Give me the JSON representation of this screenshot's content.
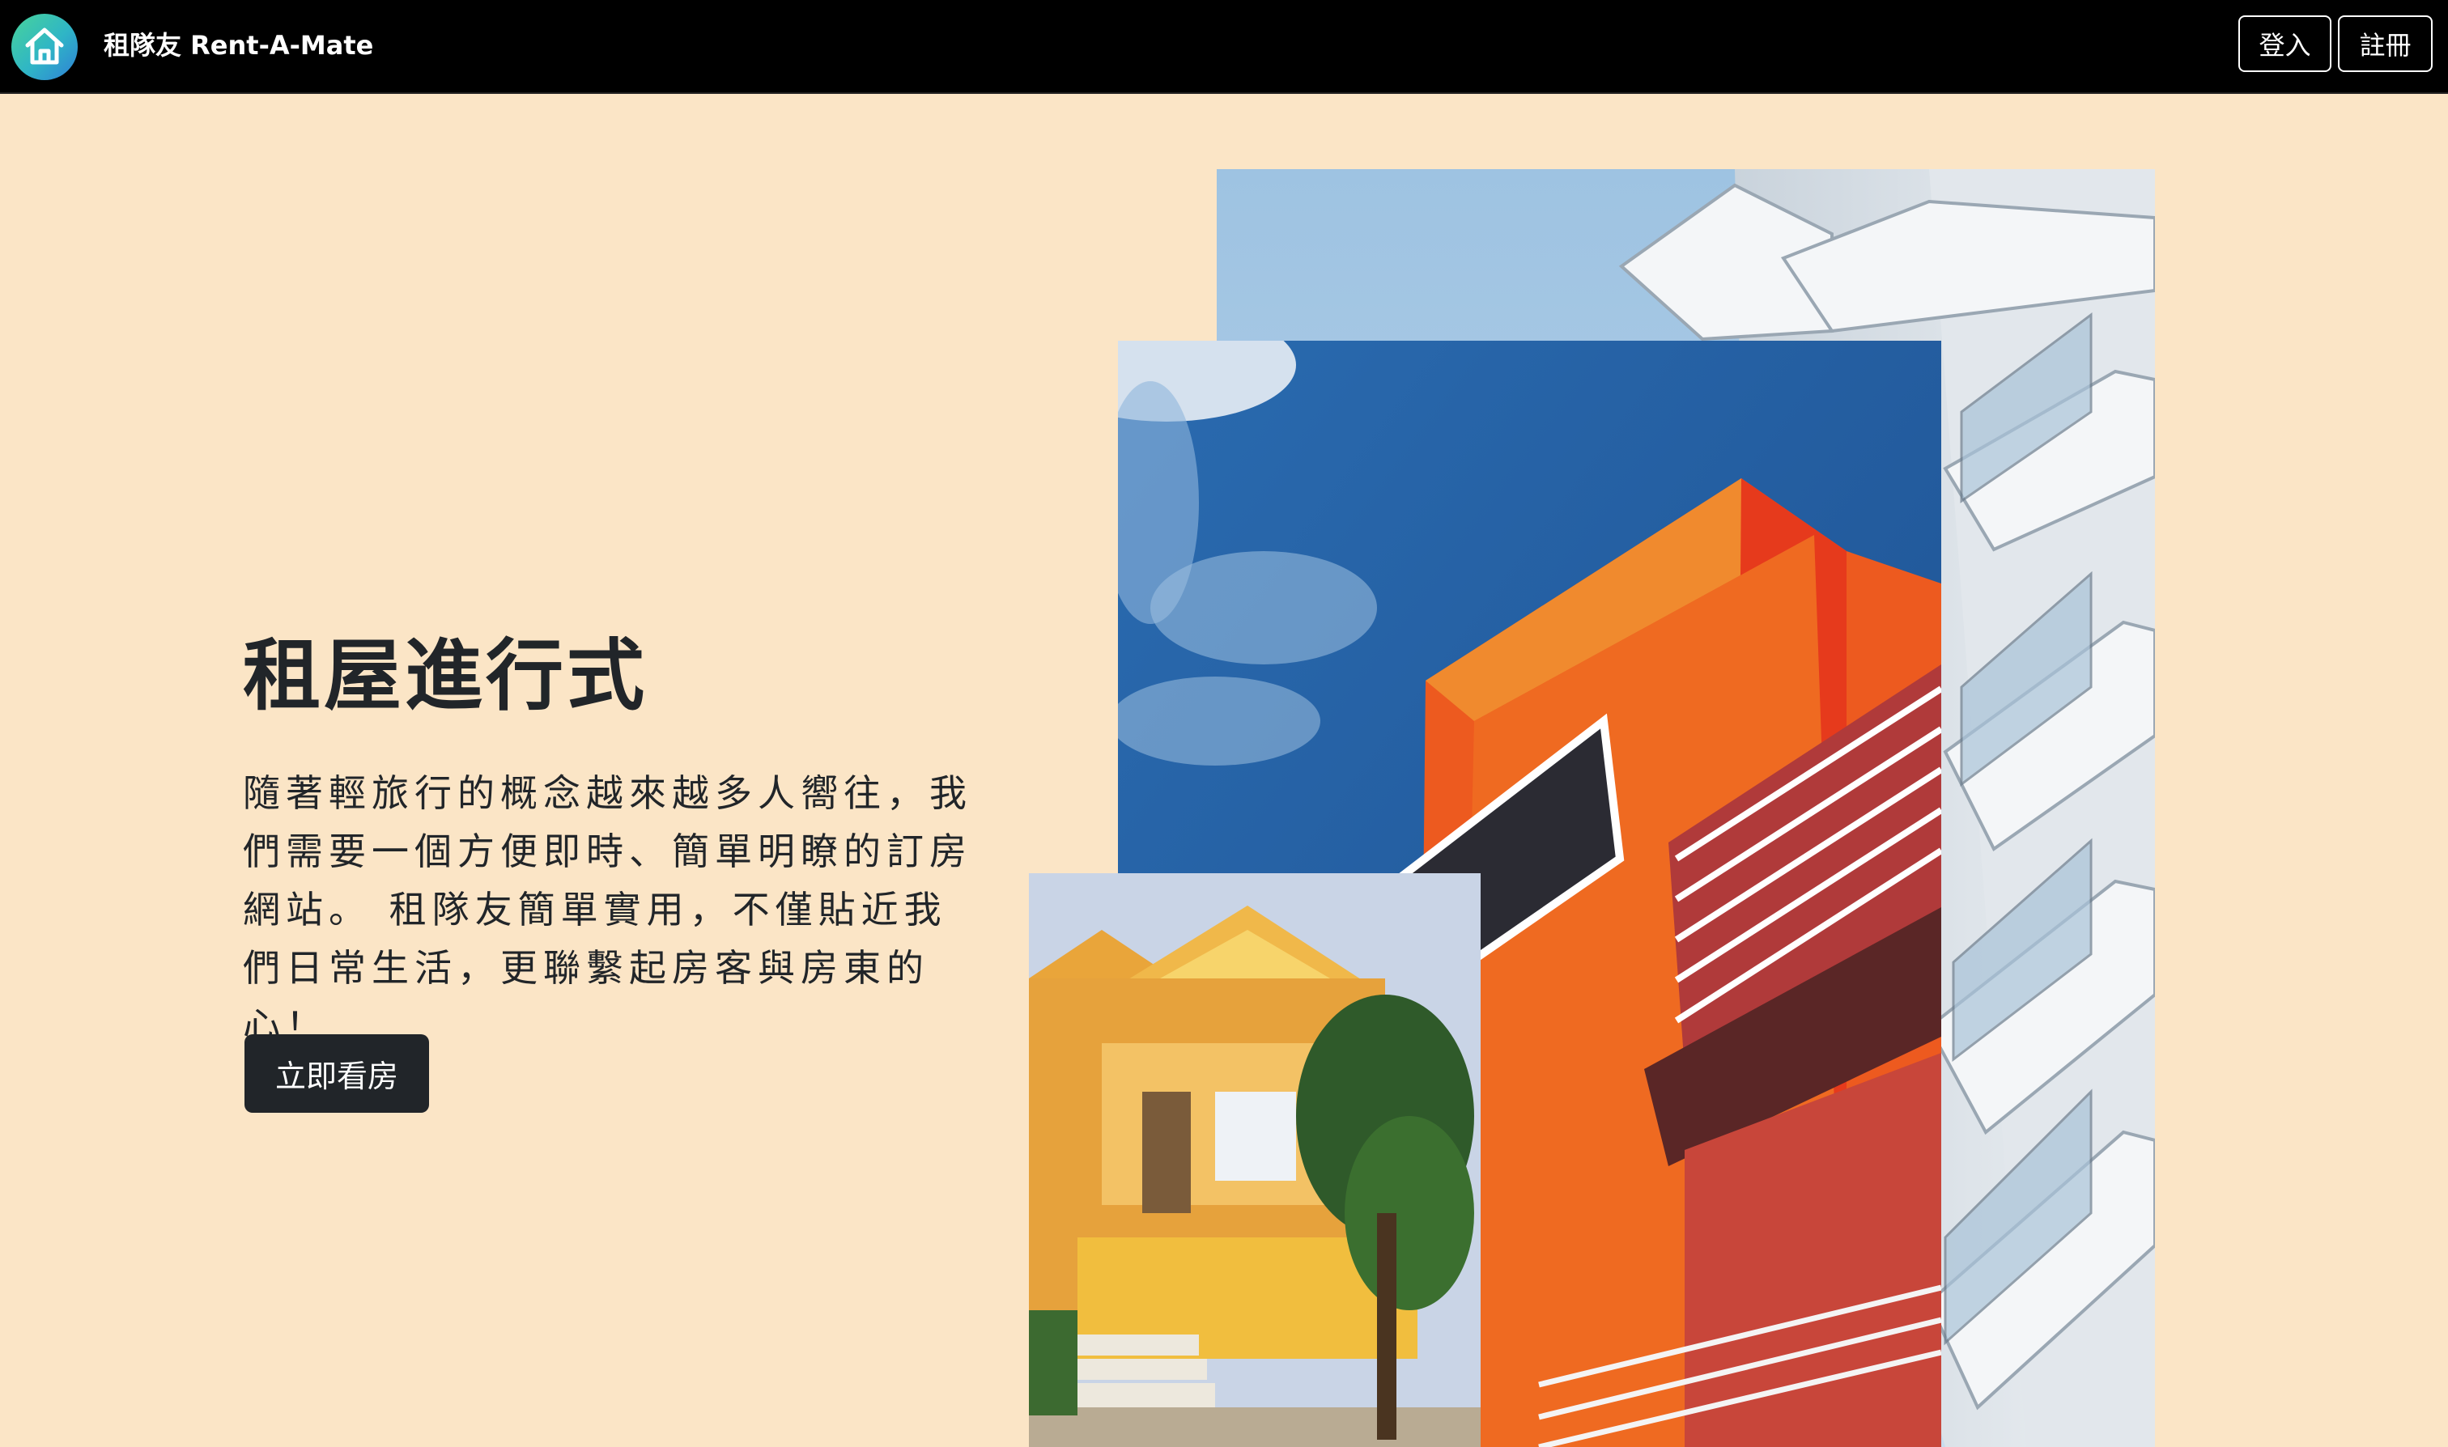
{
  "navbar": {
    "brand": "租隊友 Rent-A-Mate",
    "logo_icon": "house-icon",
    "login_label": "登入",
    "register_label": "註冊"
  },
  "hero": {
    "title": "租屋進行式",
    "description": "隨著輕旅行的概念越來越多人嚮往，我們需要一個方便即時、簡單明瞭的訂房網站。 租隊友簡單實用，不僅貼近我們日常生活，更聯繫起房客與房東的心！",
    "cta_label": "立即看房"
  },
  "colors": {
    "page_background": "#fbe5c6",
    "navbar_background": "#000000",
    "button_dark": "#212529",
    "logo_gradient": [
      "#48d49a",
      "#2f7fd6"
    ]
  }
}
